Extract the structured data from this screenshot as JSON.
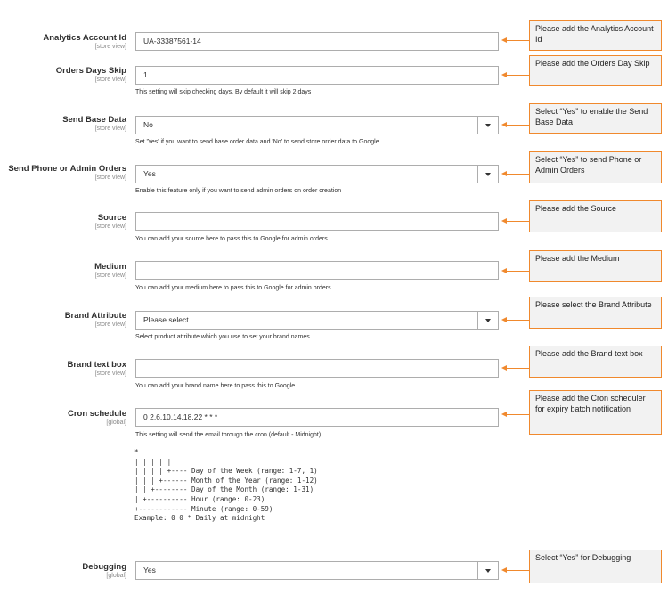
{
  "fields": [
    {
      "label": "Analytics Account Id",
      "scope": "[store view]",
      "value": "UA-33387561-14",
      "type": "text",
      "note": "",
      "callout": "Please add the Analytics Account Id"
    },
    {
      "label": "Orders Days Skip",
      "scope": "[store view]",
      "value": "1",
      "type": "text",
      "note": "This setting will skip checking days. By default it will skip 2 days",
      "callout": "Please add the Orders Day Skip"
    },
    {
      "label": "Send Base Data",
      "scope": "[store view]",
      "value": "No",
      "type": "select",
      "note": "Set 'Yes' if you want to send base order data and 'No' to send store order data to Google",
      "callout": "Select “Yes” to enable the Send Base Data"
    },
    {
      "label": "Send Phone or Admin Orders",
      "scope": "[store view]",
      "value": "Yes",
      "type": "select",
      "note": "Enable this feature only if you want to send admin orders on order creation",
      "callout": "Select “Yes” to send Phone or Admin Orders"
    },
    {
      "label": "Source",
      "scope": "[store view]",
      "value": "",
      "type": "text",
      "note": "You can add your source here to pass this to Google for admin orders",
      "callout": "Please add the Source"
    },
    {
      "label": "Medium",
      "scope": "[store view]",
      "value": "",
      "type": "text",
      "note": "You can add your medium here to pass this to Google for admin orders",
      "callout": "Please add the Medium"
    },
    {
      "label": "Brand Attribute",
      "scope": "[store view]",
      "value": "Please select",
      "type": "select",
      "note": "Select product attribute which you use to set your brand names",
      "callout": "Please select the Brand Attribute"
    },
    {
      "label": "Brand text box",
      "scope": "[store view]",
      "value": "",
      "type": "text",
      "note": "You can add your brand name here to pass this to Google",
      "callout": "Please add the Brand text box"
    },
    {
      "label": "Cron schedule",
      "scope": "[global]",
      "value": "0 2,6,10,14,18,22 * * *",
      "type": "text",
      "note": "This setting will send the email through the cron (default - Midnight)",
      "callout": "Please add the Cron scheduler for expiry batch notification"
    },
    {
      "label": "Debugging",
      "scope": "[global]",
      "value": "Yes",
      "type": "select",
      "note": "",
      "callout": "Select “Yes” for Debugging"
    }
  ],
  "cron_help": "*\n| | | | |\n| | | | +---- Day of the Week (range: 1-7, 1)\n| | | +------ Month of the Year (range: 1-12)\n| | +-------- Day of the Month (range: 1-31)\n| +---------- Hour (range: 0-23)\n+------------ Minute (range: 0-59)\nExample: 0 0 * Daily at midnight",
  "colors": {
    "callout_border": "#f0892d",
    "callout_bg": "#f2f2f2",
    "field_border": "#adadad"
  }
}
